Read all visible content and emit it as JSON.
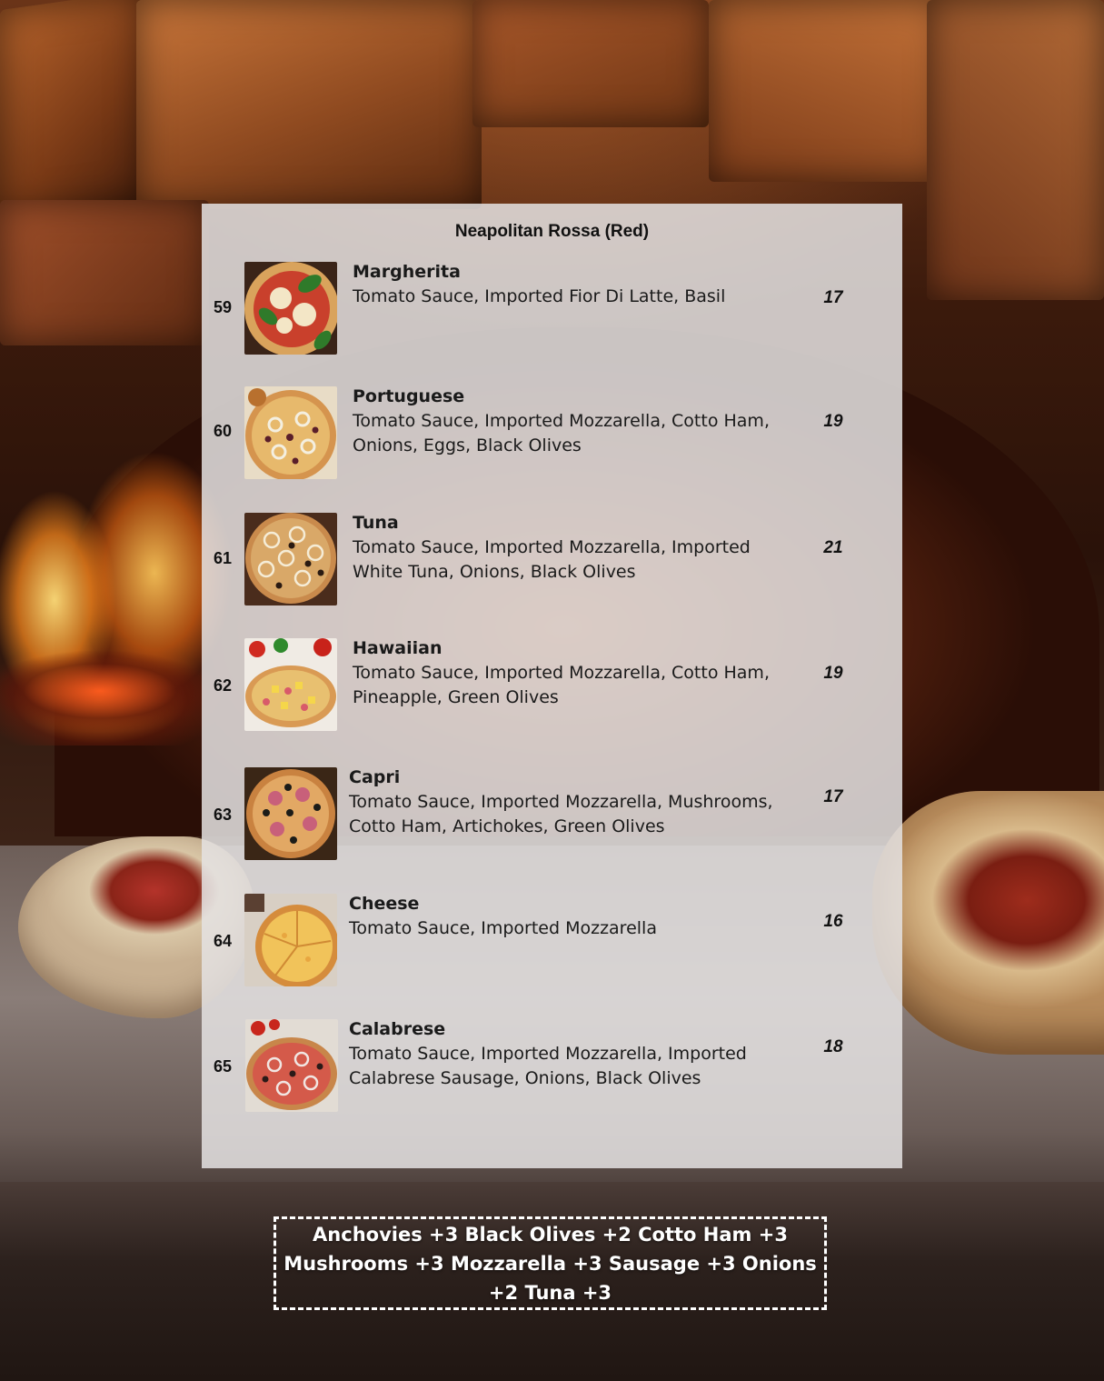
{
  "menu": {
    "section_title": "Neapolitan Rossa (Red)",
    "items": [
      {
        "number": "59",
        "name": "Margherita",
        "description": "Tomato Sauce, Imported Fior Di Latte, Basil",
        "price": "17",
        "image_icon": "pizza-margherita-photo"
      },
      {
        "number": "60",
        "name": "Portuguese",
        "description": "Tomato Sauce, Imported Mozzarella, Cotto Ham, Onions, Eggs, Black Olives",
        "price": "19",
        "image_icon": "pizza-portuguese-photo"
      },
      {
        "number": "61",
        "name": "Tuna",
        "description": "Tomato Sauce, Imported Mozzarella, Imported White Tuna, Onions, Black Olives",
        "price": "21",
        "image_icon": "pizza-tuna-photo"
      },
      {
        "number": "62",
        "name": "Hawaiian",
        "description": "Tomato Sauce, Imported Mozzarella, Cotto Ham, Pineapple, Green Olives",
        "price": "19",
        "image_icon": "pizza-hawaiian-photo"
      },
      {
        "number": "63",
        "name": "Capri",
        "description": "Tomato Sauce, Imported Mozzarella, Mushrooms, Cotto Ham, Artichokes, Green Olives",
        "price": "17",
        "image_icon": "pizza-capri-photo"
      },
      {
        "number": "64",
        "name": "Cheese",
        "description": "Tomato Sauce, Imported Mozzarella",
        "price": "16",
        "image_icon": "pizza-cheese-photo"
      },
      {
        "number": "65",
        "name": "Calabrese",
        "description": "Tomato Sauce, Imported Mozzarella, Imported Calabrese Sausage, Onions, Black Olives",
        "price": "18",
        "image_icon": "pizza-calabrese-photo"
      }
    ]
  },
  "extras": {
    "text": "Anchovies +3 Black Olives +2 Cotto Ham +3 Mushrooms +3 Mozzarella +3 Sausage +3 Onions +2 Tuna +3"
  },
  "colors": {
    "card_background": "#e4e2e2",
    "text_dark": "#111111",
    "extras_text": "#ffffff"
  }
}
